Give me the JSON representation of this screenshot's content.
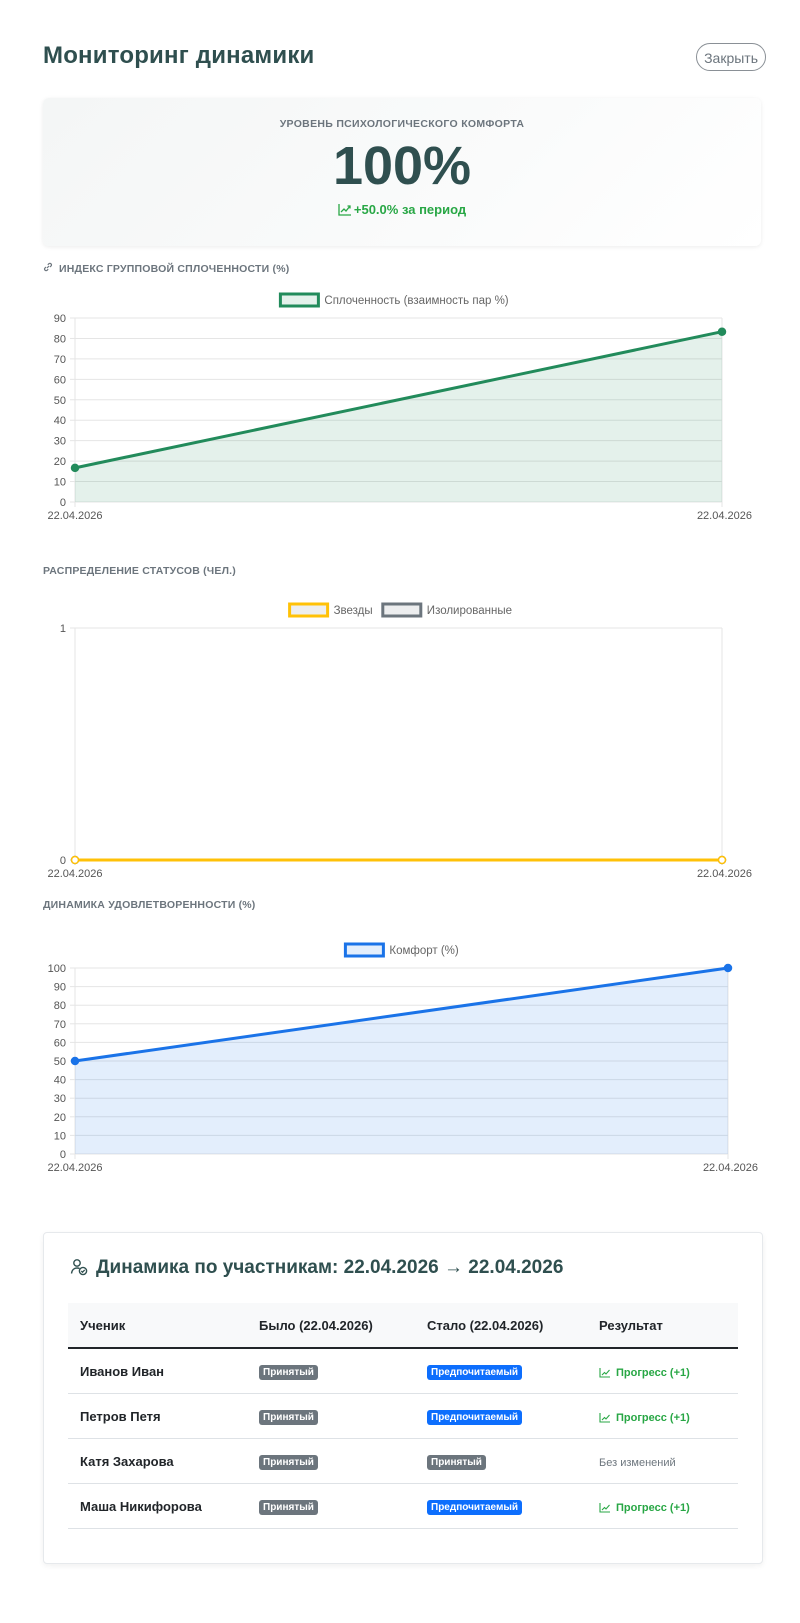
{
  "header": {
    "title": "Мониторинг динамики",
    "close_label": "Закрыть"
  },
  "comfort": {
    "label": "УРОВЕНЬ ПСИХОЛОГИЧЕСКОГО КОМФОРТА",
    "value": "100%",
    "delta": "+50.0% за период",
    "icon": "trend-up-icon"
  },
  "sections": {
    "cohesion": "ИНДЕКС ГРУППОВОЙ СПЛОЧЕННОСТИ (%)",
    "cohesion_icon": "link-icon",
    "statuses": "РАСПРЕДЕЛЕНИЕ СТАТУСОВ (ЧЕЛ.)",
    "satisfaction": "ДИНАМИКА УДОВЛЕТВОРЕННОСТИ (%)"
  },
  "colors": {
    "brand": "#2f4f4f",
    "green_series": "#228b5b",
    "yellow_series": "#ffc107",
    "gray_series": "#6c757d",
    "blue_series": "#1a73e8",
    "success": "#28a745",
    "badge_gray": "#6c757d",
    "badge_blue": "#0d6efd"
  },
  "chart_data": [
    {
      "type": "area",
      "title": "",
      "categories": [
        "22.04.2026",
        "22.04.2026"
      ],
      "series": [
        {
          "name": "Сплоченность (взаимность пар %)",
          "values": [
            16.7,
            83.3
          ]
        }
      ],
      "ylim": [
        0,
        90
      ],
      "yticks": [
        0,
        10,
        20,
        30,
        40,
        50,
        60,
        70,
        80,
        90
      ],
      "grid": true,
      "legend": "top"
    },
    {
      "type": "line",
      "title": "",
      "categories": [
        "22.04.2026",
        "22.04.2026"
      ],
      "series": [
        {
          "name": "Звезды",
          "values": [
            0,
            0
          ]
        },
        {
          "name": "Изолированные",
          "values": [
            0,
            0
          ]
        }
      ],
      "ylim": [
        0,
        1
      ],
      "yticks": [
        0,
        1
      ],
      "grid": true,
      "legend": "top"
    },
    {
      "type": "area",
      "title": "",
      "categories": [
        "22.04.2026",
        "22.04.2026"
      ],
      "series": [
        {
          "name": "Комфорт (%)",
          "values": [
            50,
            100
          ]
        }
      ],
      "ylim": [
        0,
        100
      ],
      "yticks": [
        0,
        10,
        20,
        30,
        40,
        50,
        60,
        70,
        80,
        90,
        100
      ],
      "grid": true,
      "legend": "top"
    }
  ],
  "participants": {
    "title": "Динамика по участникам: 22.04.2026 → 22.04.2026",
    "icon": "user-check-icon",
    "columns": [
      "Ученик",
      "Было (22.04.2026)",
      "Стало (22.04.2026)",
      "Результат"
    ],
    "rows": [
      {
        "name": "Иванов Иван",
        "before": "Принятый",
        "after": "Предпочитаемый",
        "result": "Прогресс (+1)"
      },
      {
        "name": "Петров Петя",
        "before": "Принятый",
        "after": "Предпочитаемый",
        "result": "Прогресс (+1)"
      },
      {
        "name": "Катя Захарова",
        "before": "Принятый",
        "after": "Принятый",
        "result": "Без изменений"
      },
      {
        "name": "Маша Никифорова",
        "before": "Принятый",
        "after": "Предпочитаемый",
        "result": "Прогресс (+1)"
      }
    ]
  }
}
